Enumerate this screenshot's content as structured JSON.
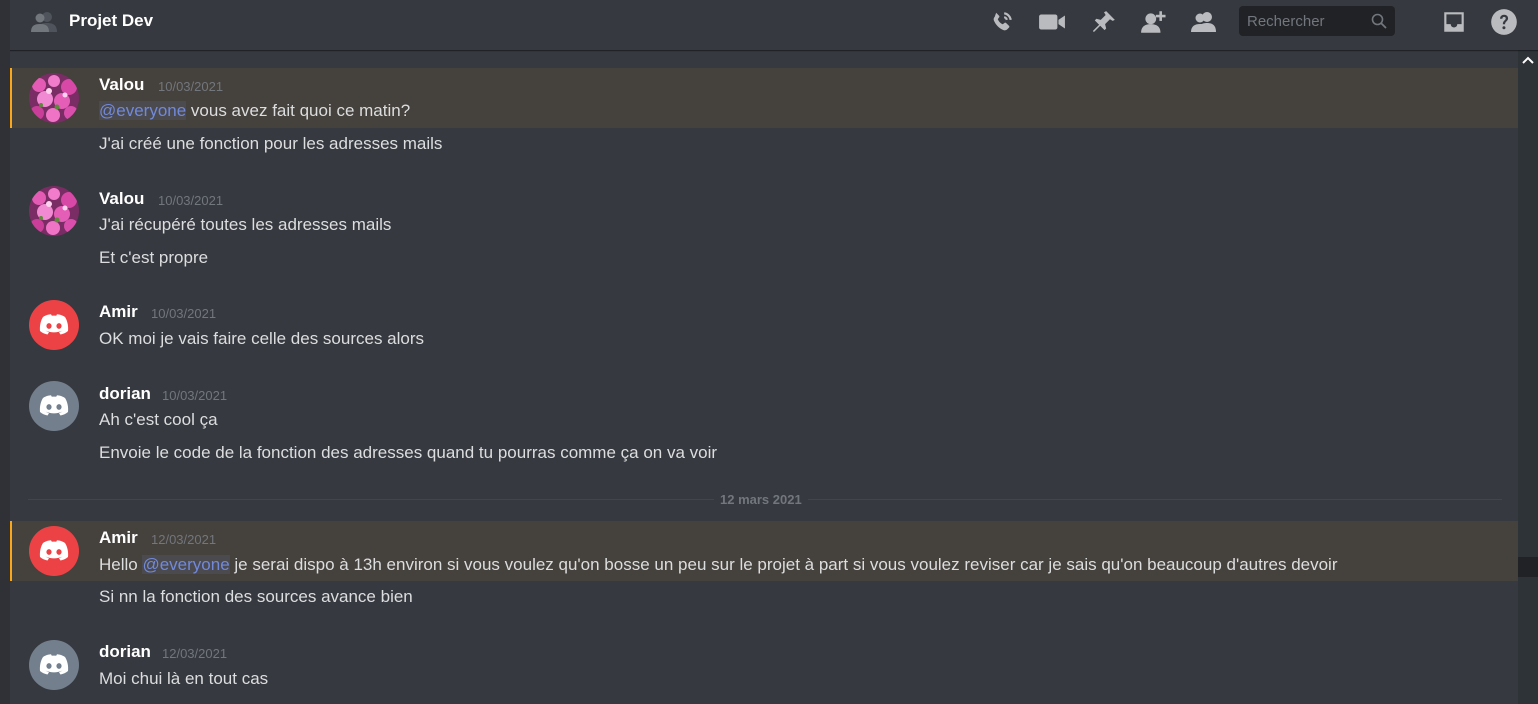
{
  "header": {
    "title": "Projet Dev",
    "search_placeholder": "Rechercher",
    "icons": [
      "call-icon",
      "video-icon",
      "pin-icon",
      "add-member-icon",
      "members-icon",
      "search-icon",
      "inbox-icon",
      "help-icon"
    ]
  },
  "mention_text": "@everyone",
  "colors": {
    "background": "#36393f",
    "header_text": "#ffffff",
    "text": "#dcddde",
    "timestamp": "#72767d",
    "mention": "#7289da",
    "mention_highlight_bar": "#faa81a",
    "avatar_red": "#ed4245",
    "avatar_grey": "#747f8d"
  },
  "messages": [
    {
      "author": "Valou",
      "timestamp": "10/03/2021",
      "avatar": "pink-flowers",
      "mention_prefix": "@everyone",
      "first_line_rest": " vous avez fait quoi ce matin?",
      "follow": "J'ai créé une fonction pour les adresses mails"
    },
    {
      "author": "Valou",
      "timestamp": "10/03/2021",
      "avatar": "pink-flowers",
      "lines": [
        "J'ai récupéré toutes les adresses mails",
        "Et c'est propre"
      ]
    },
    {
      "author": "Amir",
      "timestamp": "10/03/2021",
      "avatar": "discord-red",
      "lines": [
        "OK moi je vais faire celle des sources alors"
      ]
    },
    {
      "author": "dorian",
      "timestamp": "10/03/2021",
      "avatar": "discord-grey",
      "lines": [
        "Ah c'est cool ça",
        "Envoie le code de la fonction des adresses quand tu pourras comme ça on va voir"
      ]
    },
    {
      "author": "Amir",
      "timestamp": "12/03/2021",
      "avatar": "discord-red",
      "first_line_start": "Hello ",
      "mention_prefix": "@everyone",
      "first_line_rest": " je serai dispo à 13h environ si vous voulez qu'on bosse un peu sur le projet à part si vous voulez reviser car je sais qu'on beaucoup d'autres devoir",
      "follow": "Si nn la fonction des sources avance bien"
    },
    {
      "author": "dorian",
      "timestamp": "12/03/2021",
      "avatar": "discord-grey",
      "lines": [
        "Moi chui là en tout cas"
      ]
    }
  ],
  "date_divider": "12 mars 2021"
}
